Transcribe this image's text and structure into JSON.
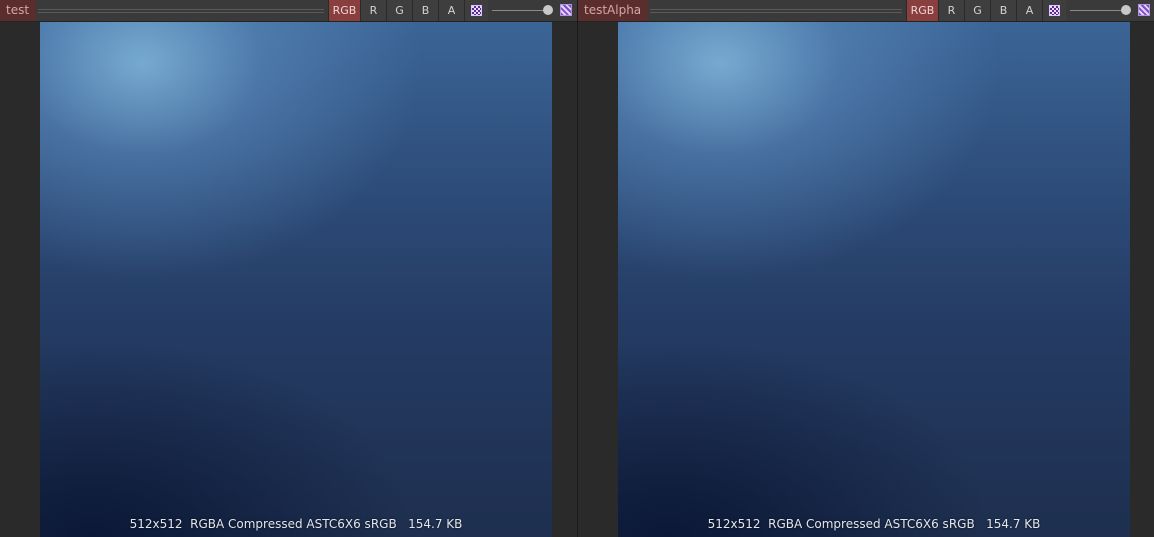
{
  "panels": [
    {
      "title": "test",
      "channels": [
        "RGB",
        "R",
        "G",
        "B",
        "A"
      ],
      "active_channel": "RGB",
      "mip_slider_value": 1.0,
      "checker_icon": "checkerboard-icon",
      "alpha_icon": "transparency-hatch-icon",
      "info": "512x512  RGBA Compressed ASTC6X6 sRGB   154.7 KB"
    },
    {
      "title": "testAlpha",
      "channels": [
        "RGB",
        "R",
        "G",
        "B",
        "A"
      ],
      "active_channel": "RGB",
      "mip_slider_value": 1.0,
      "checker_icon": "checkerboard-icon",
      "alpha_icon": "transparency-hatch-icon",
      "info": "512x512  RGBA Compressed ASTC6X6 sRGB   154.7 KB"
    }
  ],
  "colors": {
    "active_tab": "#8a3f3f",
    "title_tab": "#5b2e2e",
    "toolbar": "#3a3a3a",
    "background": "#282828"
  }
}
